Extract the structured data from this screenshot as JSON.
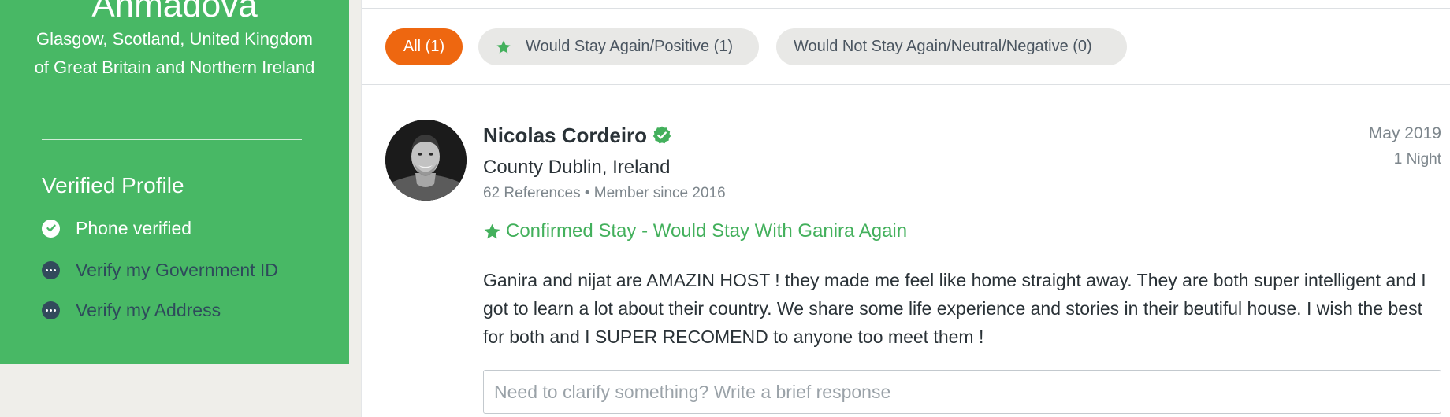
{
  "profile": {
    "name": "Ahmadova",
    "location": "Glasgow, Scotland, United Kingdom of Great Britain and Northern Ireland"
  },
  "verification": {
    "heading": "Verified Profile",
    "items": [
      {
        "label": "Phone verified",
        "status": "verified",
        "icon": "check-circle-icon"
      },
      {
        "label": "Verify my Government ID",
        "status": "unverified",
        "icon": "more-dots-icon"
      },
      {
        "label": "Verify my Address",
        "status": "unverified",
        "icon": "more-dots-icon"
      }
    ]
  },
  "filters": {
    "all": "All (1)",
    "positive": "Would Stay Again/Positive (1)",
    "negative": "Would Not Stay Again/Neutral/Negative (0)",
    "active": "all"
  },
  "review": {
    "reviewer": {
      "name": "Nicolas Cordeiro",
      "verified": true,
      "location": "County Dublin, Ireland",
      "meta": "62 References • Member since 2016"
    },
    "date": "May 2019",
    "nights": "1 Night",
    "confirmation": "Confirmed Stay - Would Stay With Ganira Again",
    "body": "Ganira and nijat are AMAZIN HOST ! they made me feel like home straight away. They are both super intelligent and I got to learn a lot about their country. We share some life experience and stories in their beutiful house. I wish the best for both and I SUPER RECOMEND to anyone too meet them !"
  },
  "response": {
    "placeholder": "Need to clarify something? Write a brief response",
    "value": ""
  },
  "colors": {
    "sidebar_green": "#48b865",
    "accent_orange": "#ee6710",
    "confirm_green": "#43b05c",
    "pill_gray": "#e8e8e6",
    "unverified_icon": "#324a5c"
  }
}
